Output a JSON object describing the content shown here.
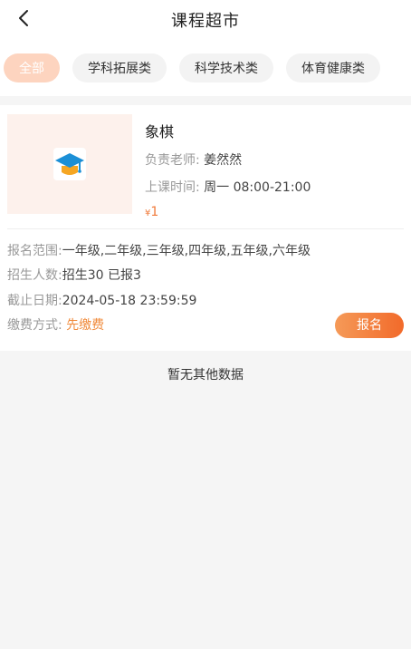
{
  "header": {
    "title": "课程超市",
    "back_icon": "chevron-left-icon"
  },
  "tabs": [
    {
      "label": "全部",
      "active": true
    },
    {
      "label": "学科拓展类",
      "active": false
    },
    {
      "label": "科学技术类",
      "active": false
    },
    {
      "label": "体育健康类",
      "active": false
    }
  ],
  "course": {
    "thumbnail_icon": "graduation-cap-icon",
    "name": "象棋",
    "teacher_label": "负责老师:",
    "teacher": "姜然然",
    "time_label": "上课时间:",
    "time": "周一 08:00-21:00",
    "price_symbol": "¥",
    "price": "1",
    "scope_label": "报名范围:",
    "scope": "一年级,二年级,三年级,四年级,五年级,六年级",
    "enroll_label": "招生人数:",
    "enroll": "招生30 已报3",
    "deadline_label": "截止日期:",
    "deadline": "2024-05-18 23:59:59",
    "pay_label": "缴费方式:",
    "pay": "先缴费",
    "signup_label": "报名"
  },
  "footer": {
    "no_more": "暂无其他数据"
  },
  "colors": {
    "accent": "#f26a2a",
    "tab_active_bg": "#fdd4bf",
    "price": "#f07a3a"
  }
}
